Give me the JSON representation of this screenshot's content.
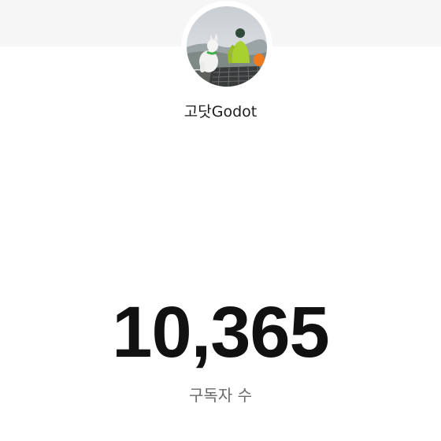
{
  "channel": {
    "name": "고닷Godot",
    "avatar_icon": "channel-avatar-photo"
  },
  "stats": {
    "subscriber_count": "10,365",
    "subscriber_label": "구독자 수"
  },
  "colors": {
    "top_band": "#f6f6f6",
    "background": "#ffffff",
    "count_text": "#111111",
    "label_text": "#6a6a6a"
  }
}
